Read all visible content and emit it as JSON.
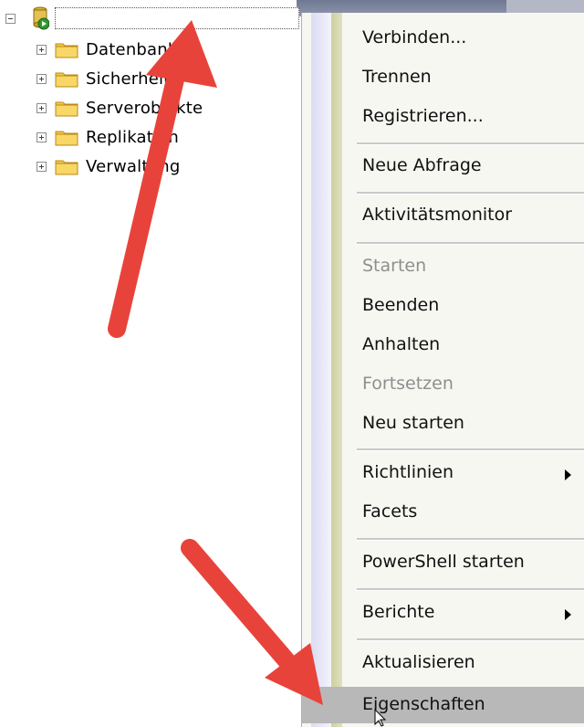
{
  "tree": {
    "nodes": [
      {
        "label": "Datenbanken"
      },
      {
        "label": "Sicherheit"
      },
      {
        "label": "Serverobjekte"
      },
      {
        "label": "Replikation"
      },
      {
        "label": "Verwaltung"
      }
    ]
  },
  "menu": {
    "items": [
      {
        "label": "Verbinden...",
        "enabled": true
      },
      {
        "label": "Trennen",
        "enabled": true
      },
      {
        "label": "Registrieren...",
        "enabled": true
      },
      {
        "label": "Neue Abfrage",
        "enabled": true
      },
      {
        "label": "Aktivitätsmonitor",
        "enabled": true
      },
      {
        "label": "Starten",
        "enabled": false
      },
      {
        "label": "Beenden",
        "enabled": true
      },
      {
        "label": "Anhalten",
        "enabled": true
      },
      {
        "label": "Fortsetzen",
        "enabled": false
      },
      {
        "label": "Neu starten",
        "enabled": true
      },
      {
        "label": "Richtlinien",
        "enabled": true,
        "submenu": true
      },
      {
        "label": "Facets",
        "enabled": true
      },
      {
        "label": "PowerShell starten",
        "enabled": true
      },
      {
        "label": "Berichte",
        "enabled": true,
        "submenu": true
      },
      {
        "label": "Aktualisieren",
        "enabled": true
      },
      {
        "label": "Eigenschaften",
        "enabled": true,
        "highlighted": true
      }
    ]
  },
  "colors": {
    "arrow": "#e8433a",
    "menu_background": "#f7f7f2",
    "highlight": "#b8b8b8",
    "disabled_text": "#8e8e8e"
  },
  "icons": {
    "server": "server-running-icon",
    "folder": "folder-icon",
    "submenu": "chevron-right-icon"
  }
}
